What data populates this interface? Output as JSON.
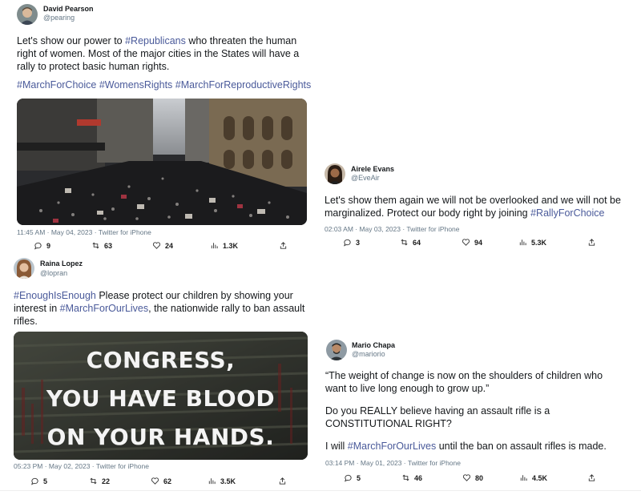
{
  "tweets": [
    {
      "name": "David Pearson",
      "handle": "@pearing",
      "text_a": "Let's show our power to ",
      "tag_a": "#Republicans",
      "text_b": " who threaten the human right of women. Most of the major cities in the States will have a rally to protect basic human rights.",
      "hashtags": "#MarchForChoice #WomensRights #MarchForReproductiveRights",
      "meta": "11:45 AM · May 04, 2023 · Twitter for iPhone",
      "replies": "9",
      "retweets": "63",
      "likes": "24",
      "views": "1.3K"
    },
    {
      "name": "Airele Evans",
      "handle": "@EveAir",
      "text_a": "Let's show them again we will not be overlooked and we will not be marginalized. Protect our body right by joining ",
      "tag_a": "#RallyForChoice",
      "meta": "02:03 AM · May 03, 2023 · Twitter for iPhone",
      "replies": "3",
      "retweets": "64",
      "likes": "94",
      "views": "5.3K"
    },
    {
      "name": "Raina Lopez",
      "handle": "@lopran",
      "tag_a": "#EnoughIsEnough",
      "text_a": " Please protect our children by showing your interest in ",
      "tag_b": "#MarchForOurLives",
      "text_b": ", the nationwide rally to ban assault rifles.",
      "image_lines": [
        "CONGRESS,",
        "YOU HAVE BLOOD",
        "ON YOUR HANDS."
      ],
      "meta": "05:23 PM · May 02, 2023 · Twitter for iPhone",
      "replies": "5",
      "retweets": "22",
      "likes": "62",
      "views": "3.5K"
    },
    {
      "name": "Mario Chapa",
      "handle": "@mariorio",
      "quote": "“The weight of change is now on the shoulders of children who want to live long enough to grow up.”",
      "question": "Do you REALLY believe having an assault rifle is a CONSTITUTIONAL RIGHT?",
      "text_a": "I will ",
      "tag_a": "#MarchForOurLives",
      "text_b": " until the ban on assault rifles is made.",
      "meta": "03:14 PM · May 01, 2023 · Twitter for iPhone",
      "replies": "5",
      "retweets": "46",
      "likes": "80",
      "views": "4.5K"
    }
  ],
  "icons": [
    "reply-icon",
    "retweet-icon",
    "like-icon",
    "views-icon",
    "share-icon"
  ],
  "colors": {
    "hashtag": "#4a5a9a",
    "text": "#14171a",
    "muted": "#657786"
  }
}
